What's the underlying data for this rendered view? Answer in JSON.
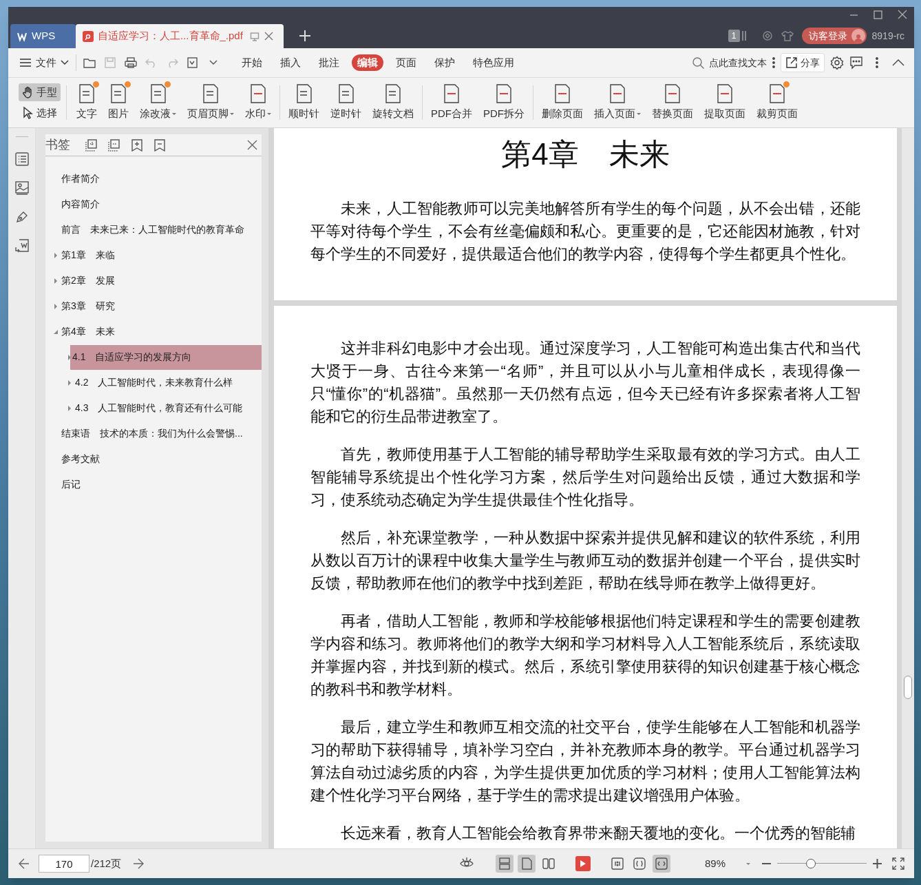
{
  "tabs": [
    {
      "kind": "home",
      "label": "WPS",
      "selected": false
    },
    {
      "kind": "doc",
      "label": "自适应学习：人工...育革命_.pdf",
      "selected": true
    }
  ],
  "title_bar": {
    "window_badge": "1",
    "login": "访客登录",
    "version": "8919-rc"
  },
  "menu": {
    "file": "文件",
    "tabs": [
      {
        "label": "开始",
        "selected": false
      },
      {
        "label": "插入",
        "selected": false
      },
      {
        "label": "批注",
        "selected": false
      },
      {
        "label": "编辑",
        "selected": true
      },
      {
        "label": "页面",
        "selected": false
      },
      {
        "label": "保护",
        "selected": false
      },
      {
        "label": "特色应用",
        "selected": false
      }
    ],
    "search": "点此查找文本",
    "share": "分享"
  },
  "ribbon": {
    "modes": [
      {
        "label": "手型",
        "selected": true
      },
      {
        "label": "选择",
        "selected": false
      }
    ],
    "tool_groups": [
      {
        "tools": [
          {
            "label": "文字",
            "dropdown": false,
            "badge": true
          },
          {
            "label": "图片",
            "dropdown": false,
            "badge": true
          },
          {
            "label": "涂改液",
            "dropdown": true,
            "badge": true
          },
          {
            "label": "页眉页脚",
            "dropdown": true,
            "badge": false
          },
          {
            "label": "水印",
            "dropdown": true,
            "badge": false
          }
        ]
      },
      {
        "tools": [
          {
            "label": "顺时针",
            "dropdown": false,
            "badge": false
          },
          {
            "label": "逆时针",
            "dropdown": false,
            "badge": false
          },
          {
            "label": "旋转文档",
            "dropdown": false,
            "badge": false
          }
        ]
      },
      {
        "tools": [
          {
            "label": "PDF合并",
            "dropdown": false,
            "badge": false
          },
          {
            "label": "PDF拆分",
            "dropdown": false,
            "badge": false
          }
        ]
      },
      {
        "tools": [
          {
            "label": "删除页面",
            "dropdown": false,
            "badge": false
          },
          {
            "label": "插入页面",
            "dropdown": true,
            "badge": false
          },
          {
            "label": "替换页面",
            "dropdown": false,
            "badge": false
          },
          {
            "label": "提取页面",
            "dropdown": false,
            "badge": false
          },
          {
            "label": "裁剪页面",
            "dropdown": false,
            "badge": true
          }
        ]
      }
    ]
  },
  "sidebar": {
    "title": "书签",
    "items": [
      {
        "label": "作者简介",
        "selected": false
      },
      {
        "label": "内容简介",
        "selected": false
      },
      {
        "label": "前言　未来已来：人工智能时代的教育革命",
        "selected": false
      },
      {
        "label": "第1章　来临",
        "selected": false,
        "expanded": false
      },
      {
        "label": "第2章　发展",
        "selected": false,
        "expanded": false
      },
      {
        "label": "第3章　研究",
        "selected": false,
        "expanded": false
      },
      {
        "label": "第4章　未来",
        "selected": false,
        "expanded": true,
        "children": [
          {
            "label": "4.1　自适应学习的发展方向",
            "selected": true,
            "expanded": false
          },
          {
            "label": "4.2　人工智能时代，未来教育什么样",
            "selected": false,
            "expanded": false
          },
          {
            "label": "4.3　人工智能时代，教育还有什么可能",
            "selected": false,
            "expanded": false
          }
        ]
      },
      {
        "label": "结束语　技术的本质：我们为什么会警惕...",
        "selected": false
      },
      {
        "label": "参考文献",
        "selected": false
      },
      {
        "label": "后记",
        "selected": false
      }
    ]
  },
  "document": {
    "pages": [
      {
        "heading": "第4章　未来",
        "paragraphs": [
          "未来，人工智能教师可以完美地解答所有学生的每个问题，从不会出错，还能平等对待每个学生，不会有丝毫偏颇和私心。更重要的是，它还能因材施教，针对每个学生的不同爱好，提供最适合他们的教学内容，使得每个学生都更具个性化。"
        ]
      },
      {
        "paragraphs": [
          "这并非科幻电影中才会出现。通过深度学习，人工智能可构造出集古代和当代大贤于一身、古往今来第一“名师”，并且可以从小与儿童相伴成长，表现得像一只“懂你”的“机器猫”。虽然那一天仍然有点远，但今天已经有许多探索者将人工智能和它的衍生品带进教室了。",
          "首先，教师使用基于人工智能的辅导帮助学生采取最有效的学习方式。由人工智能辅导系统提出个性化学习方案，然后学生对问题给出反馈，通过大数据和学习，使系统动态确定为学生提供最佳个性化指导。",
          "然后，补充课堂教学，一种从数据中探索并提供见解和建议的软件系统，利用从数以百万计的课程中收集大量学生与教师互动的数据并创建一个平台，提供实时反馈，帮助教师在他们的教学中找到差距，帮助在线导师在教学上做得更好。",
          "再者，借助人工智能，教师和学校能够根据他们特定课程和学生的需要创建教学内容和练习。教师将他们的教学大纲和学习材料导入人工智能系统后，系统读取并掌握内容，并找到新的模式。然后，系统引擎使用获得的知识创建基于核心概念的教科书和教学材料。",
          "最后，建立学生和教师互相交流的社交平台，使学生能够在人工智能和机器学习的帮助下获得辅导，填补学习空白，并补充教师本身的教学。平台通过机器学习算法自动过滤劣质的内容，为学生提供更加优质的学习材料；使用人工智能算法构建个性化学习平台网络，基于学生的需求提出建议增强用户体验。",
          "长远来看，教育人工智能会给教育界带来翻天覆地的变化。一个优秀的智能辅"
        ]
      }
    ]
  },
  "status_bar": {
    "page": "170",
    "total": "/212页",
    "view_modes": [
      {
        "selected": true
      },
      {
        "selected": true
      },
      {
        "selected": false
      }
    ],
    "fit_modes": [
      {
        "selected": false
      },
      {
        "selected": false
      },
      {
        "selected": true
      }
    ],
    "zoom": "89%",
    "zoom_slider": {
      "level": 0.38
    }
  }
}
